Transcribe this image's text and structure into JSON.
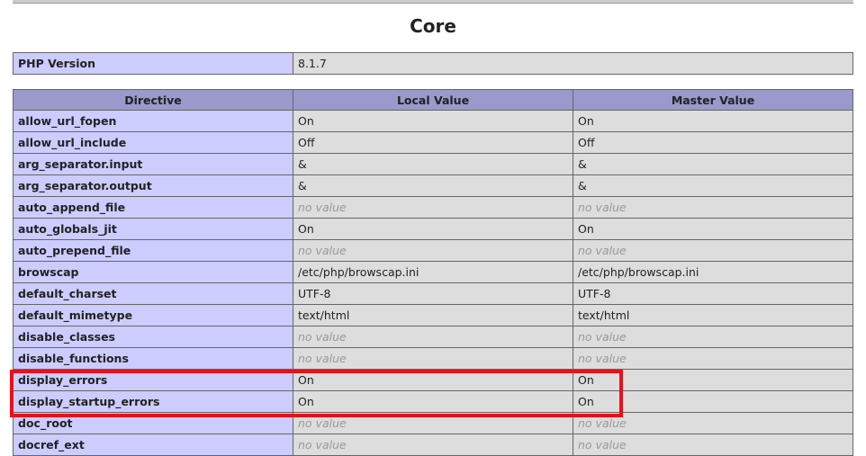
{
  "section": {
    "title": "Core"
  },
  "version": {
    "label": "PHP Version",
    "value": "8.1.7"
  },
  "table": {
    "headers": [
      "Directive",
      "Local Value",
      "Master Value"
    ],
    "rows": [
      {
        "name": "allow_url_fopen",
        "local": "On",
        "master": "On"
      },
      {
        "name": "allow_url_include",
        "local": "Off",
        "master": "Off"
      },
      {
        "name": "arg_separator.input",
        "local": "&",
        "master": "&"
      },
      {
        "name": "arg_separator.output",
        "local": "&",
        "master": "&"
      },
      {
        "name": "auto_append_file",
        "local": "no value",
        "master": "no value"
      },
      {
        "name": "auto_globals_jit",
        "local": "On",
        "master": "On"
      },
      {
        "name": "auto_prepend_file",
        "local": "no value",
        "master": "no value"
      },
      {
        "name": "browscap",
        "local": "/etc/php/browscap.ini",
        "master": "/etc/php/browscap.ini"
      },
      {
        "name": "default_charset",
        "local": "UTF-8",
        "master": "UTF-8"
      },
      {
        "name": "default_mimetype",
        "local": "text/html",
        "master": "text/html"
      },
      {
        "name": "disable_classes",
        "local": "no value",
        "master": "no value"
      },
      {
        "name": "disable_functions",
        "local": "no value",
        "master": "no value"
      },
      {
        "name": "display_errors",
        "local": "On",
        "master": "On"
      },
      {
        "name": "display_startup_errors",
        "local": "On",
        "master": "On"
      },
      {
        "name": "doc_root",
        "local": "no value",
        "master": "no value"
      },
      {
        "name": "docref_ext",
        "local": "no value",
        "master": "no value"
      }
    ]
  },
  "highlight": {
    "color": "#e8101a",
    "covers_rows": [
      "display_errors",
      "display_startup_errors"
    ]
  }
}
